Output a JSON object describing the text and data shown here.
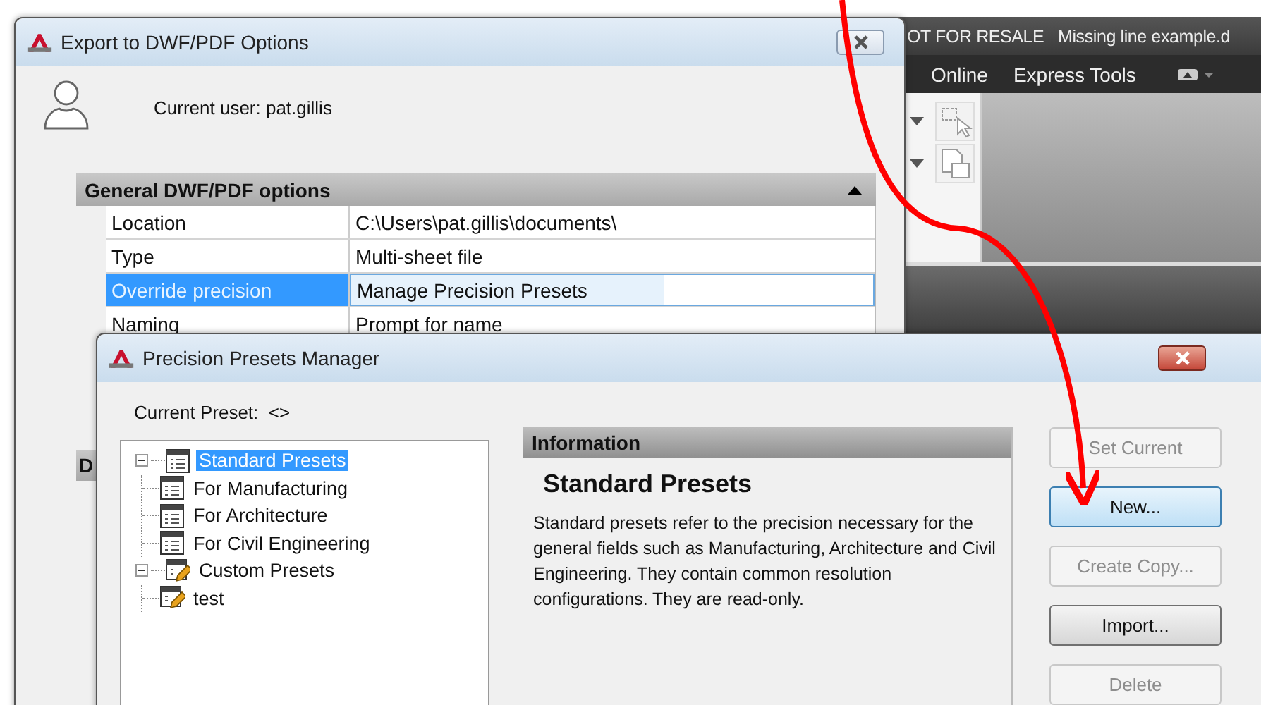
{
  "background_window": {
    "title": "OT FOR RESALE   Missing line example.d",
    "ribbon_tabs": [
      "Online",
      "Express Tools"
    ]
  },
  "export_dialog": {
    "title": "Export to DWF/PDF Options",
    "current_user": "Current user: pat.gillis",
    "section": {
      "title": "General DWF/PDF options",
      "expanded": true,
      "rows": [
        {
          "label": "Location",
          "value": "C:\\Users\\pat.gillis\\documents\\",
          "selected": false
        },
        {
          "label": "Type",
          "value": "Multi-sheet file",
          "selected": false
        },
        {
          "label": "Override precision",
          "value": "Manage Precision Presets",
          "selected": true
        },
        {
          "label": "Naming",
          "value": "Prompt for name",
          "selected": false
        }
      ]
    },
    "next_section_title": "D"
  },
  "presets_dialog": {
    "title": "Precision Presets Manager",
    "current_preset": "Current Preset:  <>",
    "tree": [
      {
        "label": "Standard Presets",
        "kind": "standard",
        "selected": true,
        "expanded": true,
        "children": [
          {
            "label": "For Manufacturing",
            "kind": "standard",
            "selected": false
          },
          {
            "label": "For Architecture",
            "kind": "standard",
            "selected": false
          },
          {
            "label": "For Civil Engineering",
            "kind": "standard",
            "selected": false
          }
        ]
      },
      {
        "label": "Custom Presets",
        "kind": "custom",
        "selected": false,
        "expanded": true,
        "children": [
          {
            "label": "test",
            "kind": "custom",
            "selected": false
          }
        ]
      }
    ],
    "info": {
      "header": "Information",
      "title": "Standard Presets",
      "text": "Standard presets refer to the precision necessary for the general fields such as Manufacturing, Architecture and Civil Engineering. They contain common resolution configurations. They are read-only."
    },
    "buttons": [
      {
        "label": "Set Current",
        "disabled": true,
        "highlighted": false
      },
      {
        "label": "New...",
        "disabled": false,
        "highlighted": true
      },
      {
        "label": "Create Copy...",
        "disabled": true,
        "highlighted": false
      },
      {
        "label": "Import...",
        "disabled": false,
        "highlighted": false
      },
      {
        "label": "Delete",
        "disabled": true,
        "highlighted": false
      }
    ]
  }
}
